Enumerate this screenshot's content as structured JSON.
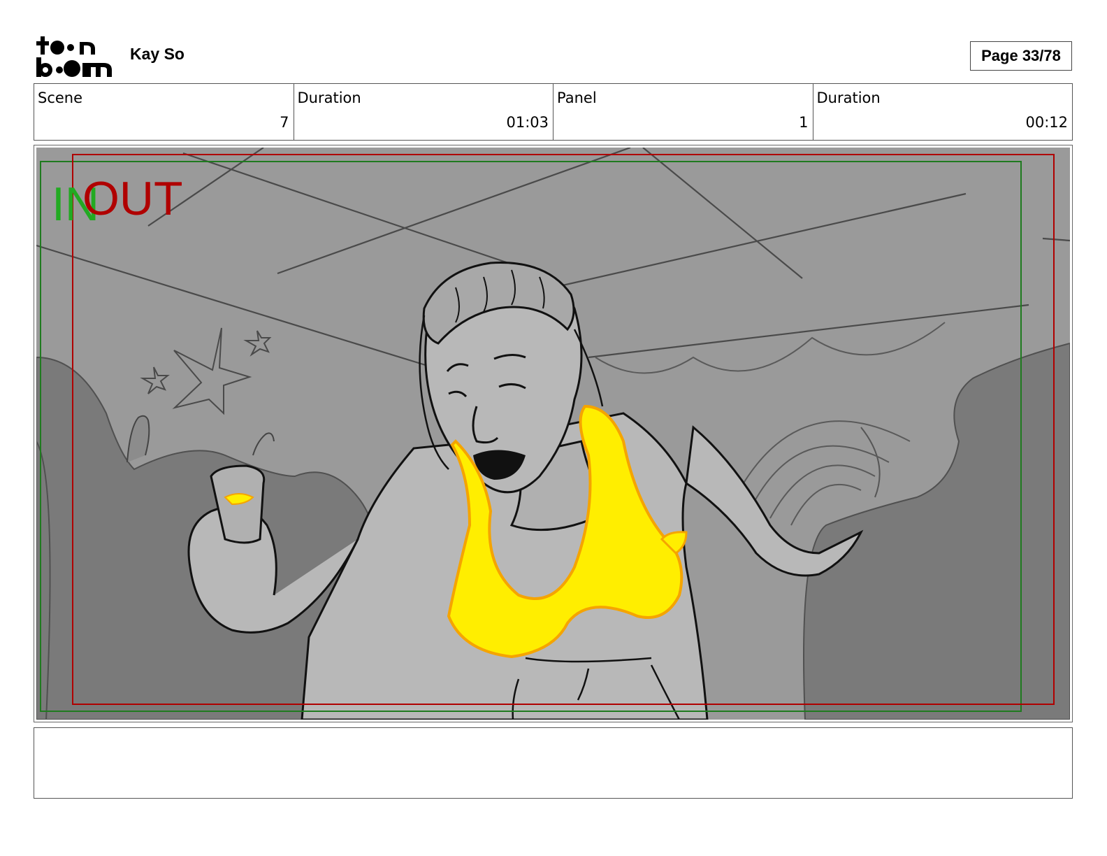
{
  "header": {
    "logo_text": "toonboom",
    "author": "Kay So",
    "page_label": "Page 33/78"
  },
  "info": [
    {
      "label": "Scene",
      "value": "7"
    },
    {
      "label": "Duration",
      "value": "01:03"
    },
    {
      "label": "Panel",
      "value": "1"
    },
    {
      "label": "Duration",
      "value": "00:12"
    }
  ],
  "panel": {
    "in_marker": "IN",
    "out_marker": "OUT",
    "colors": {
      "background": "#9a9a9a",
      "crowd": "#7a7a7a",
      "skin": "#b8b8b8",
      "fire": "#ffee00",
      "fire_outline": "#f5a400",
      "in_frame": "#1f7a1f",
      "out_frame": "#b00000"
    }
  },
  "notes": ""
}
